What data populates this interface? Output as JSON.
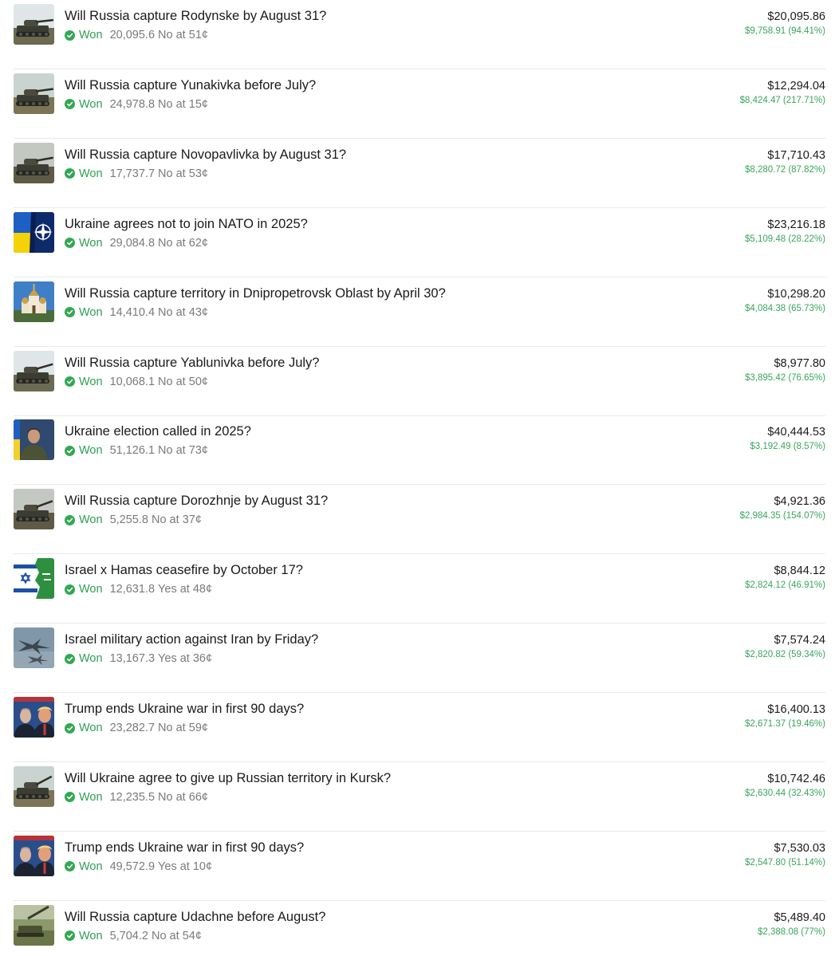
{
  "colors": {
    "won_green": "#2f9e4f",
    "pnl_green": "#3aa65a",
    "divider": "#e9e9e9",
    "muted_text": "#7a7a7a"
  },
  "positions": [
    {
      "title": "Will Russia capture Rodynske by August 31?",
      "status": "Won",
      "shares": "20,095.6",
      "outcome": "No",
      "price": "51¢",
      "value": "$20,095.86",
      "pnl": "$9,758.91 (94.41%)",
      "thumbnail": "tank-image"
    },
    {
      "title": "Will Russia capture Yunakivka before July?",
      "status": "Won",
      "shares": "24,978.8",
      "outcome": "No",
      "price": "15¢",
      "value": "$12,294.04",
      "pnl": "$8,424.47 (217.71%)",
      "thumbnail": "tank-image"
    },
    {
      "title": "Will Russia capture Novopavlivka by August 31?",
      "status": "Won",
      "shares": "17,737.7",
      "outcome": "No",
      "price": "53¢",
      "value": "$17,710.43",
      "pnl": "$8,280.72 (87.82%)",
      "thumbnail": "tank-image"
    },
    {
      "title": "Ukraine agrees not to join NATO in 2025?",
      "status": "Won",
      "shares": "29,084.8",
      "outcome": "No",
      "price": "62¢",
      "value": "$23,216.18",
      "pnl": "$5,109.48 (28.22%)",
      "thumbnail": "ukraine-nato-flags-image"
    },
    {
      "title": "Will Russia capture territory in Dnipropetrovsk Oblast by April 30?",
      "status": "Won",
      "shares": "14,410.4",
      "outcome": "No",
      "price": "43¢",
      "value": "$10,298.20",
      "pnl": "$4,084.38 (65.73%)",
      "thumbnail": "church-image"
    },
    {
      "title": "Will Russia capture Yablunivka before July?",
      "status": "Won",
      "shares": "10,068.1",
      "outcome": "No",
      "price": "50¢",
      "value": "$8,977.80",
      "pnl": "$3,895.42 (76.65%)",
      "thumbnail": "tank-image"
    },
    {
      "title": "Ukraine election called in 2025?",
      "status": "Won",
      "shares": "51,126.1",
      "outcome": "No",
      "price": "73¢",
      "value": "$40,444.53",
      "pnl": "$3,192.49 (8.57%)",
      "thumbnail": "portrait-image"
    },
    {
      "title": "Will Russia capture Dorozhnje by August 31?",
      "status": "Won",
      "shares": "5,255.8",
      "outcome": "No",
      "price": "37¢",
      "value": "$4,921.36",
      "pnl": "$2,984.35 (154.07%)",
      "thumbnail": "tank-image"
    },
    {
      "title": "Israel x Hamas ceasefire by October 17?",
      "status": "Won",
      "shares": "12,631.8",
      "outcome": "Yes",
      "price": "48¢",
      "value": "$8,844.12",
      "pnl": "$2,824.12 (46.91%)",
      "thumbnail": "israel-hamas-flags-image"
    },
    {
      "title": "Israel military action against Iran by Friday?",
      "status": "Won",
      "shares": "13,167.3",
      "outcome": "Yes",
      "price": "36¢",
      "value": "$7,574.24",
      "pnl": "$2,820.82 (59.34%)",
      "thumbnail": "jets-image"
    },
    {
      "title": "Trump ends Ukraine war in first 90 days?",
      "status": "Won",
      "shares": "23,282.7",
      "outcome": "No",
      "price": "59¢",
      "value": "$16,400.13",
      "pnl": "$2,671.37 (19.46%)",
      "thumbnail": "leaders-image"
    },
    {
      "title": "Will Ukraine agree to give up Russian territory in Kursk?",
      "status": "Won",
      "shares": "12,235.5",
      "outcome": "No",
      "price": "66¢",
      "value": "$10,742.46",
      "pnl": "$2,630.44 (32.43%)",
      "thumbnail": "tank-image"
    },
    {
      "title": "Trump ends Ukraine war in first 90 days?",
      "status": "Won",
      "shares": "49,572.9",
      "outcome": "Yes",
      "price": "10¢",
      "value": "$7,530.03",
      "pnl": "$2,547.80 (51.14%)",
      "thumbnail": "leaders-image"
    },
    {
      "title": "Will Russia capture Udachne before August?",
      "status": "Won",
      "shares": "5,704.2",
      "outcome": "No",
      "price": "54¢",
      "value": "$5,489.40",
      "pnl": "$2,388.08 (77%)",
      "thumbnail": "artillery-image"
    }
  ]
}
